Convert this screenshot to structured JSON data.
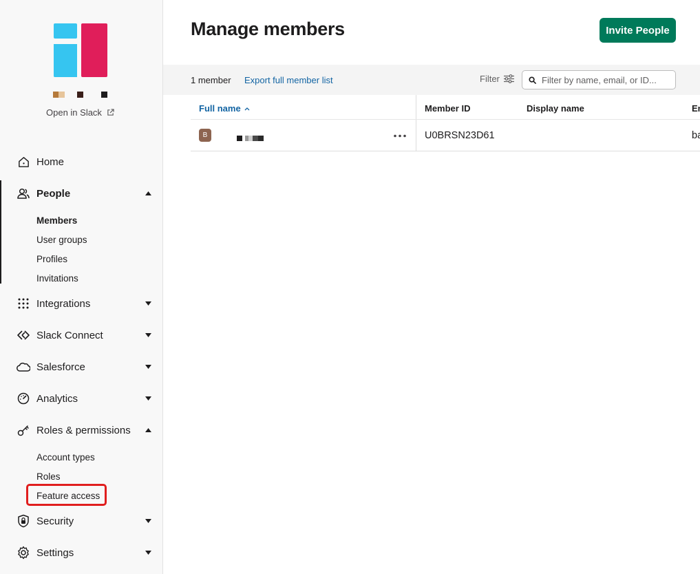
{
  "sidebar": {
    "open_in_slack": "Open in Slack",
    "nav": {
      "home": "Home",
      "people": "People",
      "integrations": "Integrations",
      "slack_connect": "Slack Connect",
      "salesforce": "Salesforce",
      "analytics": "Analytics",
      "roles_permissions": "Roles & permissions",
      "security": "Security",
      "settings": "Settings"
    },
    "people_sub": {
      "members": "Members",
      "user_groups": "User groups",
      "profiles": "Profiles",
      "invitations": "Invitations"
    },
    "roles_sub": {
      "account_types": "Account types",
      "roles": "Roles",
      "feature_access": "Feature access"
    }
  },
  "header": {
    "title": "Manage members",
    "invite_label": "Invite People"
  },
  "toolbar": {
    "member_count": "1 member",
    "export_label": "Export full member list",
    "filter_label": "Filter",
    "search_placeholder": "Filter by name, email, or ID..."
  },
  "table": {
    "columns": [
      "Full name",
      "Member ID",
      "Display name",
      "En"
    ],
    "rows": [
      {
        "avatar_initial": "B",
        "member_id": "U0BRSN23D61",
        "display_name": "",
        "email_fragment": "ba"
      }
    ]
  },
  "colors": {
    "accent": "#1264a3",
    "primary_button": "#007a5a",
    "highlight": "#e01e1e",
    "logo_blue": "#36c5f0",
    "logo_red": "#e01e5a",
    "avatar": "#8d6450"
  }
}
